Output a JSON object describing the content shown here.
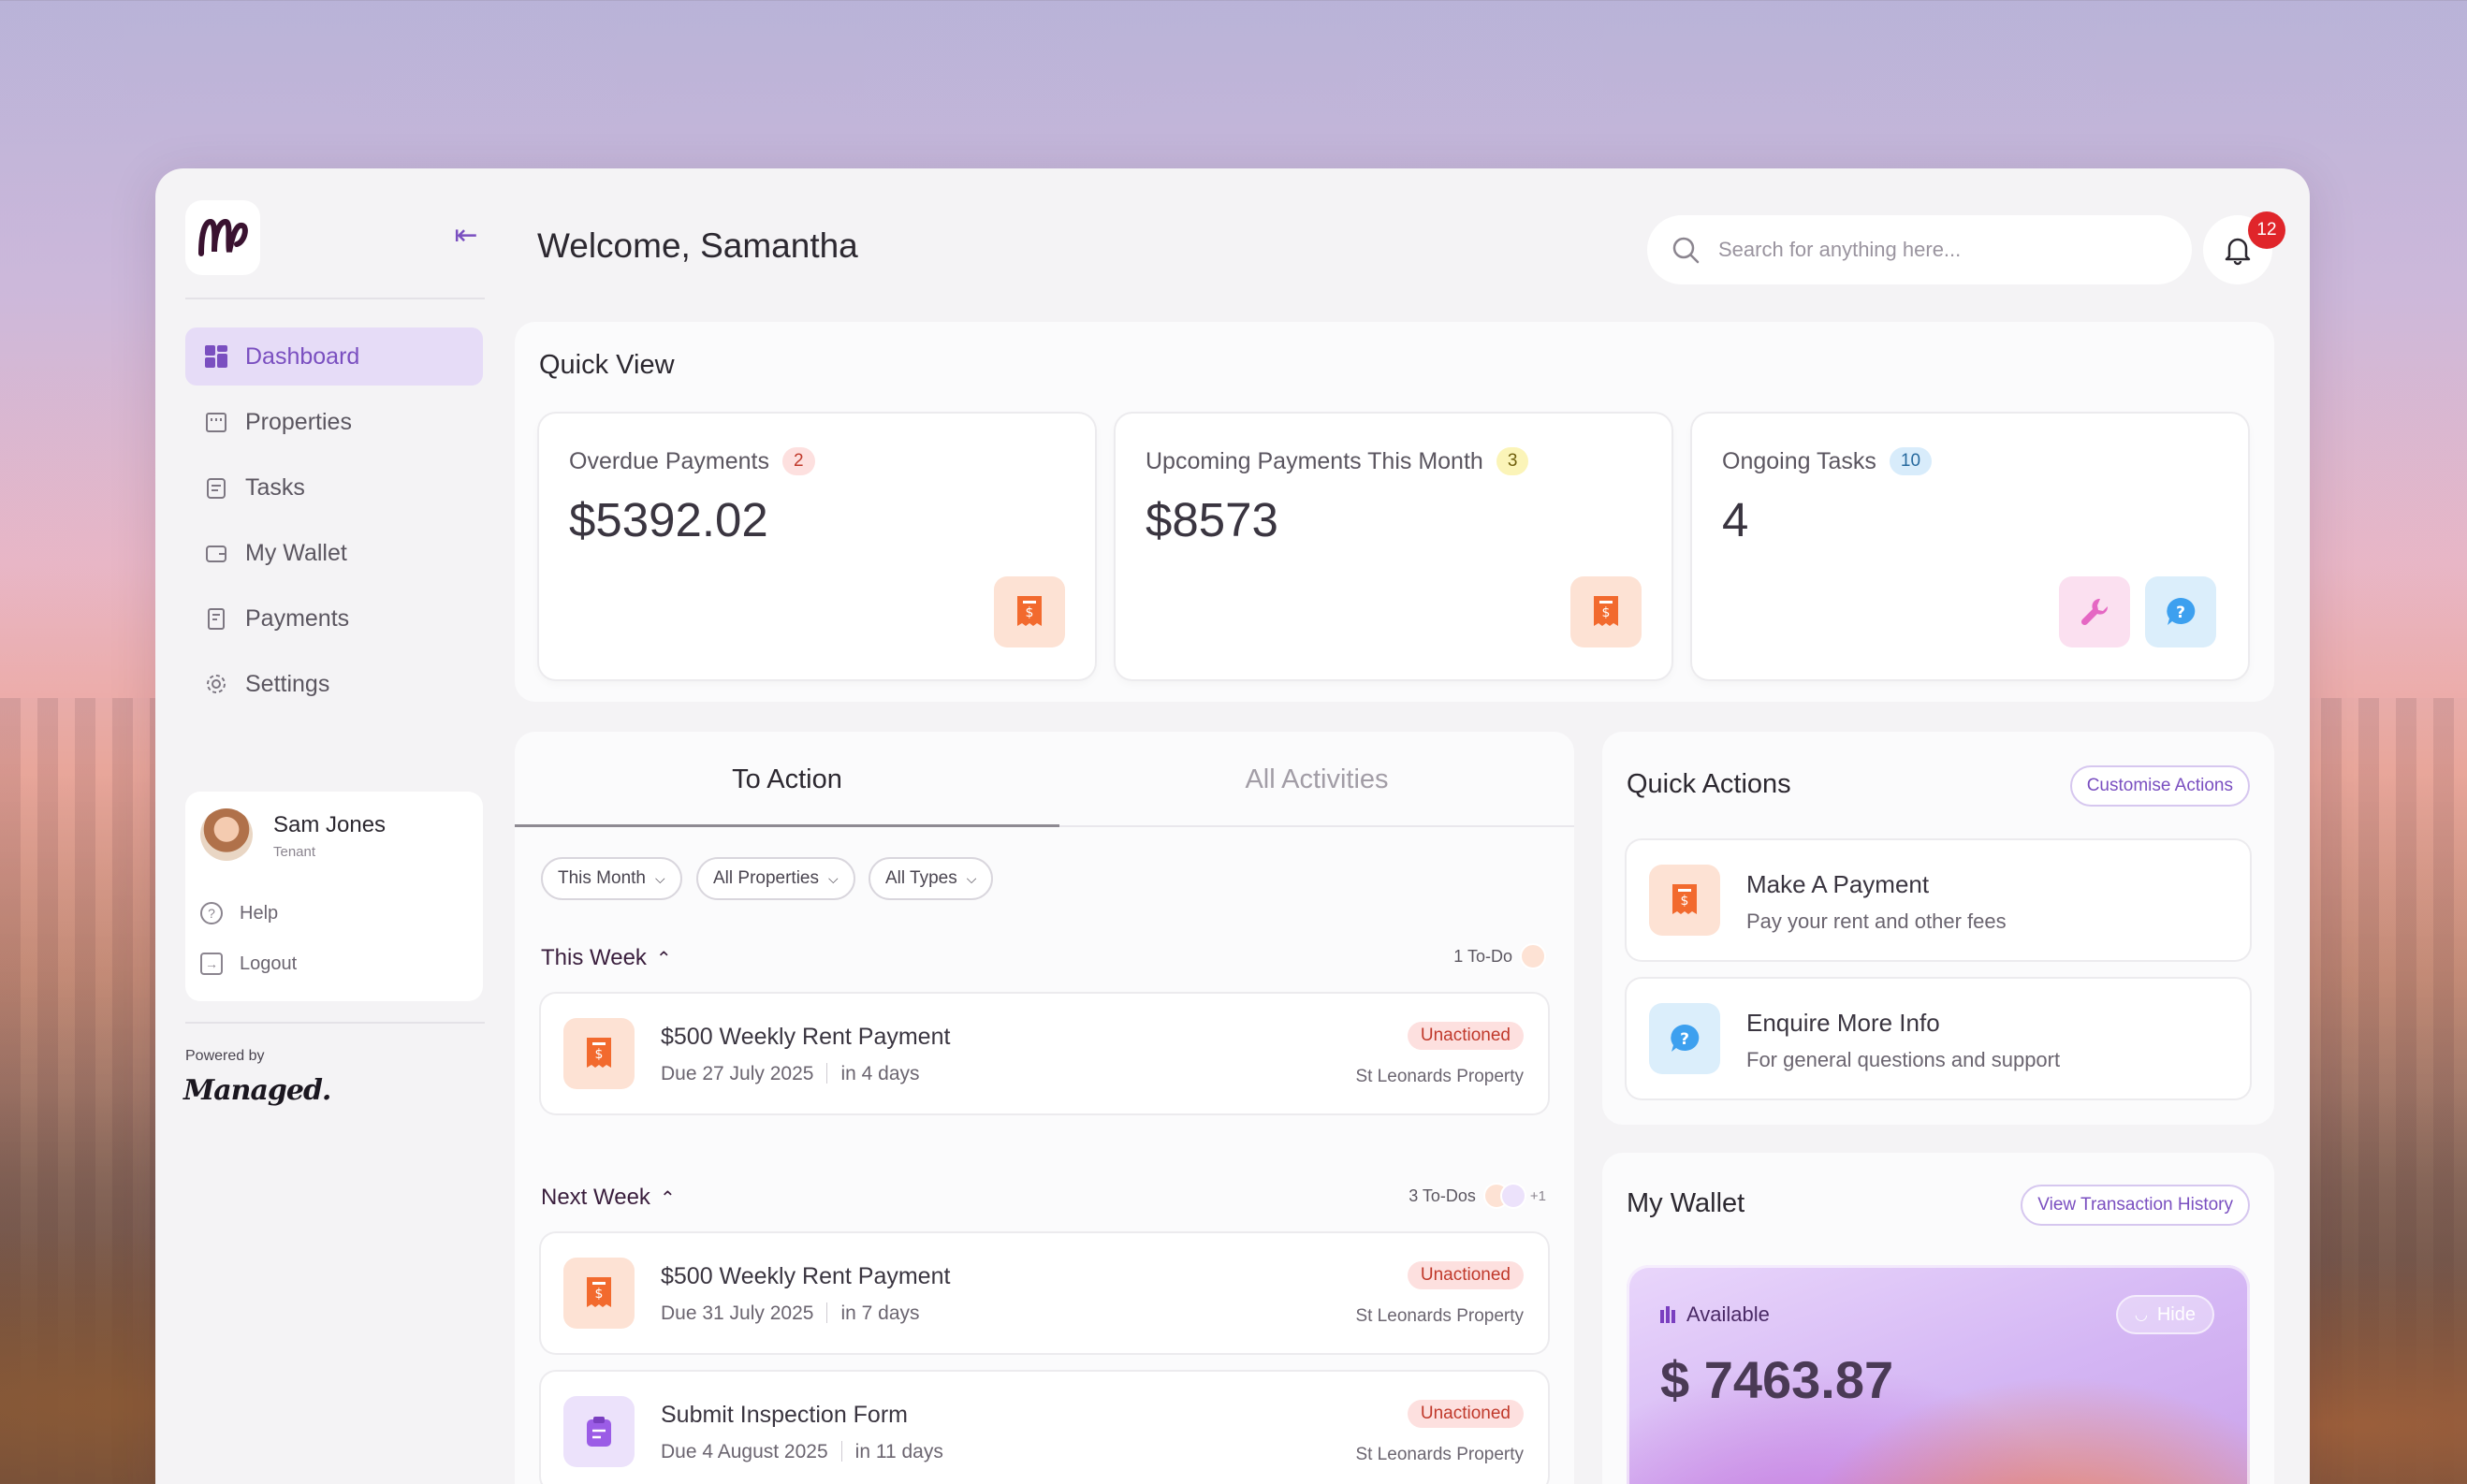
{
  "app": {
    "brand": "Managed"
  },
  "sidebar": {
    "items": [
      {
        "label": "Dashboard",
        "icon": "dashboard-icon",
        "active": true
      },
      {
        "label": "Properties",
        "icon": "building-icon",
        "active": false
      },
      {
        "label": "Tasks",
        "icon": "clipboard-icon",
        "active": false
      },
      {
        "label": "My Wallet",
        "icon": "wallet-icon",
        "active": false
      },
      {
        "label": "Payments",
        "icon": "receipt-icon",
        "active": false
      },
      {
        "label": "Settings",
        "icon": "gear-icon",
        "active": false
      }
    ],
    "user": {
      "name": "Sam Jones",
      "role": "Tenant"
    },
    "help_label": "Help",
    "logout_label": "Logout",
    "powered_by": "Powered by",
    "powered_brand": "Managed."
  },
  "header": {
    "welcome": "Welcome, Samantha",
    "search_placeholder": "Search for anything here...",
    "notification_count": "12"
  },
  "quick_view": {
    "title": "Quick View",
    "cards": [
      {
        "title": "Overdue Payments",
        "count": "2",
        "value": "$5392.02"
      },
      {
        "title": "Upcoming Payments This Month",
        "count": "3",
        "value": "$8573"
      },
      {
        "title": "Ongoing Tasks",
        "count": "10",
        "value": "4"
      }
    ]
  },
  "activities": {
    "tabs": [
      "To Action",
      "All Activities"
    ],
    "filters": [
      "This Month",
      "All Properties",
      "All Types"
    ],
    "groups": [
      {
        "title": "This Week",
        "count_label": "1 To-Do",
        "tasks": [
          {
            "title": "$500 Weekly Rent Payment",
            "due": "Due 27 July 2025",
            "relative": "in 4 days",
            "status": "Unactioned",
            "property": "St Leonards Property"
          }
        ]
      },
      {
        "title": "Next Week",
        "count_label": "3 To-Dos",
        "more": "+1",
        "tasks": [
          {
            "title": "$500 Weekly Rent Payment",
            "due": "Due 31 July 2025",
            "relative": "in 7 days",
            "status": "Unactioned",
            "property": "St Leonards Property"
          },
          {
            "title": "Submit Inspection Form",
            "due": "Due 4 August 2025",
            "relative": "in 11 days",
            "status": "Unactioned",
            "property": "St Leonards Property"
          }
        ]
      }
    ]
  },
  "quick_actions": {
    "title": "Quick Actions",
    "customise_label": "Customise Actions",
    "items": [
      {
        "title": "Make A Payment",
        "subtitle": "Pay your rent and other fees"
      },
      {
        "title": "Enquire More Info",
        "subtitle": "For general questions and support"
      }
    ]
  },
  "wallet": {
    "title": "My Wallet",
    "history_label": "View Transaction History",
    "available_label": "Available",
    "hide_label": "Hide",
    "amount": "$ 7463.87"
  },
  "colors": {
    "accent": "#7a4fc0",
    "danger": "#e0252a",
    "orange": "#f26a2e"
  }
}
